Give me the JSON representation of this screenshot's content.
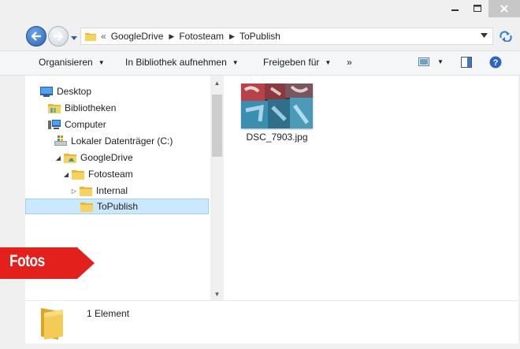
{
  "address": {
    "overflow": "«",
    "segments": [
      "GoogleDrive",
      "Fotosteam",
      "ToPublish"
    ]
  },
  "toolbar": {
    "organize": "Organisieren",
    "library": "In Bibliothek aufnehmen",
    "share": "Freigeben für",
    "more": "»"
  },
  "tree": {
    "desktop": "Desktop",
    "libraries": "Bibliotheken",
    "computer": "Computer",
    "local_disk": "Lokaler Datenträger (C:)",
    "googledrive": "GoogleDrive",
    "fotosteam": "Fotosteam",
    "internal": "Internal",
    "topublish": "ToPublish"
  },
  "files": [
    {
      "name": "DSC_7903.jpg"
    }
  ],
  "status": {
    "count_text": "1 Element"
  },
  "overlay": {
    "badge_text": "Fotos",
    "badge_color": "#e3201b"
  },
  "colors": {
    "selection_fill": "#cce8ff",
    "selection_border": "#99d1ff",
    "folder": "#f4c542"
  }
}
